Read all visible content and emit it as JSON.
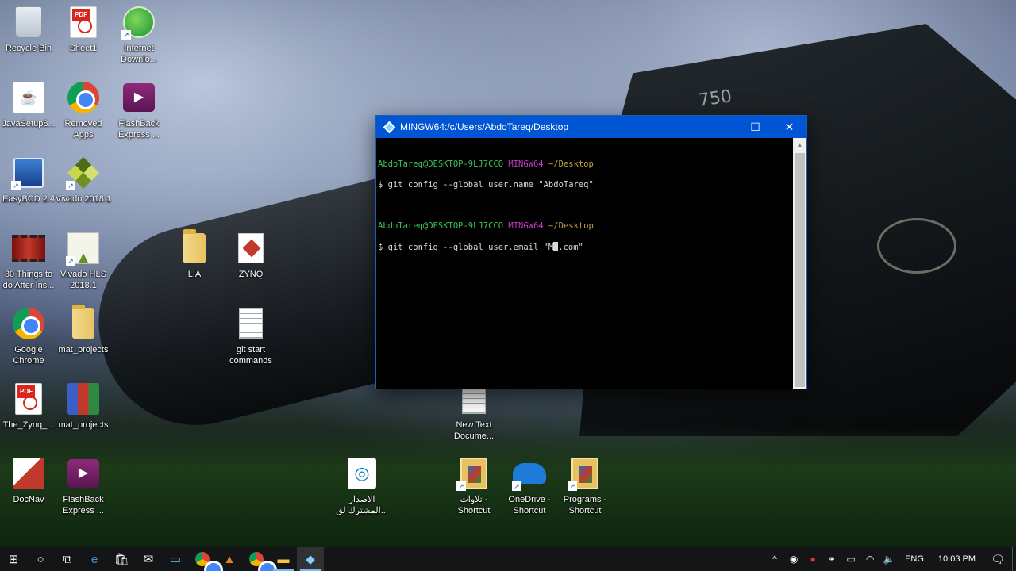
{
  "desktop": {
    "icons": [
      {
        "label": "Recycle Bin",
        "icon": "recycle-bin-icon"
      },
      {
        "label": "Sheet1",
        "icon": "pdf-icon"
      },
      {
        "label": "Internet Downlo...",
        "icon": "internet-download-manager-icon"
      },
      {
        "label": "JavaSetup8...",
        "icon": "java-icon"
      },
      {
        "label": "Removed Apps",
        "icon": "chrome-icon"
      },
      {
        "label": "FlashBack Express ...",
        "icon": "flashback-icon"
      },
      {
        "label": "EasyBCD 2.4",
        "icon": "easybcd-icon"
      },
      {
        "label": "Vivado 2018.1",
        "icon": "vivado-icon"
      },
      {
        "label": "30 Things to do After Ins...",
        "icon": "video-icon"
      },
      {
        "label": "Vivado HLS 2018.1",
        "icon": "vivado-hls-icon"
      },
      {
        "label": "LIA",
        "icon": "folder-icon"
      },
      {
        "label": "ZYNQ",
        "icon": "zynq-icon"
      },
      {
        "label": "Google Chrome",
        "icon": "chrome-icon"
      },
      {
        "label": "mat_projects",
        "icon": "folder-icon"
      },
      {
        "label": "git start commands",
        "icon": "text-file-icon"
      },
      {
        "label": "The_Zynq_...",
        "icon": "pdf-icon"
      },
      {
        "label": "mat_projects",
        "icon": "winrar-icon"
      },
      {
        "label": "New Text Docume...",
        "icon": "text-file-icon"
      },
      {
        "label": "DocNav",
        "icon": "docnav-icon"
      },
      {
        "label": "FlashBack Express ...",
        "icon": "flashback-icon"
      },
      {
        "label": "الاصدار المشترك لق...",
        "icon": "telegram-icon"
      },
      {
        "label": "تلاوات - Shortcut",
        "icon": "folder-pictures-icon"
      },
      {
        "label": "OneDrive - Shortcut",
        "icon": "onedrive-icon"
      },
      {
        "label": "Programs - Shortcut",
        "icon": "folder-pictures-icon"
      }
    ]
  },
  "window": {
    "title": "MINGW64:/c/Users/AbdoTareq/Desktop",
    "minimize": "—",
    "maximize": "☐",
    "close": "✕",
    "lines": [
      {
        "user": "AbdoTareq@DESKTOP-9LJ7CCO",
        "env": "MINGW64",
        "path": "~/Desktop"
      },
      {
        "command": "$ git config --global user.name \"AbdoTareq\""
      },
      {
        "user": "AbdoTareq@DESKTOP-9LJ7CCO",
        "env": "MINGW64",
        "path": "~/Desktop"
      },
      {
        "command_before_cursor": "$ git config --global user.email \"M",
        "command_after_cursor": ".com\""
      }
    ]
  },
  "taskbar": {
    "start": "⊞",
    "search": "○",
    "task_view": "⧉",
    "apps": [
      "edge-icon",
      "store-icon",
      "mail-icon",
      "monitor-icon",
      "chrome-icon",
      "vivado-icon",
      "chrome-icon",
      "file-explorer-icon",
      "git-bash-icon"
    ],
    "tray": {
      "lang": "ENG",
      "time": "10:03 PM"
    }
  },
  "wallpaper": {
    "number": "750"
  }
}
